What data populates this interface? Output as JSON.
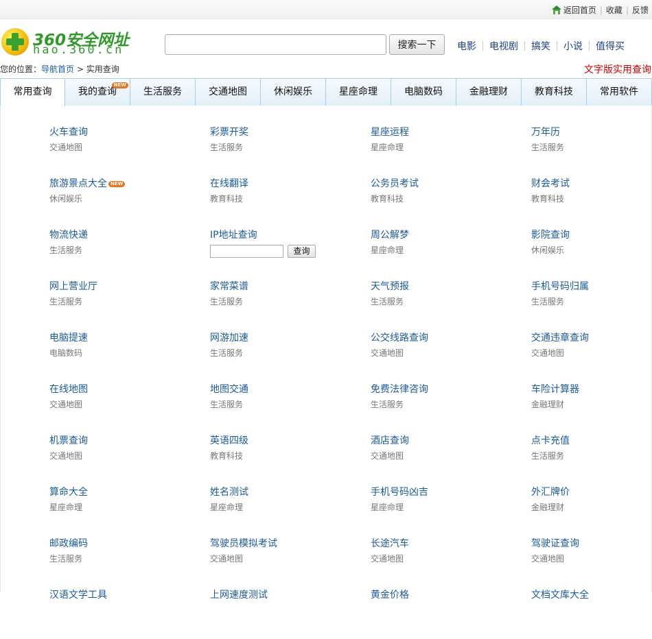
{
  "top_links": {
    "home": "返回首页",
    "favorite": "收藏",
    "feedback": "反馈"
  },
  "logo": {
    "line1": "360安全网址",
    "line2": "hao.360.cn"
  },
  "search": {
    "value": "",
    "placeholder": "",
    "button": "搜索一下"
  },
  "hot_links": [
    "电影",
    "电视剧",
    "搞笑",
    "小说",
    "值得买"
  ],
  "breadcrumb": {
    "prefix": "您的位置：",
    "home": "导航首页",
    "sep": " > ",
    "current": "实用查询"
  },
  "text_version": "文字版实用查询",
  "tabs": [
    {
      "label": "常用查询",
      "active": true
    },
    {
      "label": "我的查询",
      "badge": "NEW"
    },
    {
      "label": "生活服务"
    },
    {
      "label": "交通地图"
    },
    {
      "label": "休闲娱乐"
    },
    {
      "label": "星座命理"
    },
    {
      "label": "电脑数码"
    },
    {
      "label": "金融理财"
    },
    {
      "label": "教育科技"
    },
    {
      "label": "常用软件"
    }
  ],
  "ip_query": {
    "input_value": "",
    "button": "查询"
  },
  "items": [
    {
      "title": "火车查询",
      "category": "交通地图"
    },
    {
      "title": "彩票开奖",
      "category": "生活服务"
    },
    {
      "title": "星座运程",
      "category": "星座命理"
    },
    {
      "title": "万年历",
      "category": "生活服务"
    },
    {
      "title": "旅游景点大全",
      "category": "休闲娱乐",
      "badge": "NEW"
    },
    {
      "title": "在线翻译",
      "category": "教育科技"
    },
    {
      "title": "公务员考试",
      "category": "教育科技"
    },
    {
      "title": "财会考试",
      "category": "教育科技"
    },
    {
      "title": "物流快递",
      "category": "生活服务"
    },
    {
      "title": "IP地址查询",
      "category": ""
    },
    {
      "title": "周公解梦",
      "category": "星座命理"
    },
    {
      "title": "影院查询",
      "category": "休闲娱乐"
    },
    {
      "title": "网上营业厅",
      "category": "生活服务"
    },
    {
      "title": "家常菜谱",
      "category": "生活服务"
    },
    {
      "title": "天气预报",
      "category": "生活服务"
    },
    {
      "title": "手机号码归属",
      "category": "生活服务"
    },
    {
      "title": "电脑提速",
      "category": "电脑数码"
    },
    {
      "title": "网游加速",
      "category": "生活服务"
    },
    {
      "title": "公交线路查询",
      "category": "交通地图"
    },
    {
      "title": "交通违章查询",
      "category": "交通地图"
    },
    {
      "title": "在线地图",
      "category": "交通地图"
    },
    {
      "title": "地图交通",
      "category": "生活服务"
    },
    {
      "title": "免费法律咨询",
      "category": "生活服务"
    },
    {
      "title": "车险计算器",
      "category": "金融理财"
    },
    {
      "title": "机票查询",
      "category": "交通地图"
    },
    {
      "title": "英语四级",
      "category": "教育科技"
    },
    {
      "title": "酒店查询",
      "category": "交通地图"
    },
    {
      "title": "点卡充值",
      "category": "生活服务"
    },
    {
      "title": "算命大全",
      "category": "星座命理"
    },
    {
      "title": "姓名测试",
      "category": "星座命理"
    },
    {
      "title": "手机号码凶吉",
      "category": "星座命理"
    },
    {
      "title": "外汇牌价",
      "category": "金融理财"
    },
    {
      "title": "邮政编码",
      "category": "生活服务"
    },
    {
      "title": "驾驶员模拟考试",
      "category": "交通地图"
    },
    {
      "title": "长途汽车",
      "category": "交通地图"
    },
    {
      "title": "驾驶证查询",
      "category": "交通地图"
    },
    {
      "title": "汉语文学工具",
      "category": ""
    },
    {
      "title": "上网速度测试",
      "category": ""
    },
    {
      "title": "黄金价格",
      "category": ""
    },
    {
      "title": "文档文库大全",
      "category": ""
    }
  ]
}
